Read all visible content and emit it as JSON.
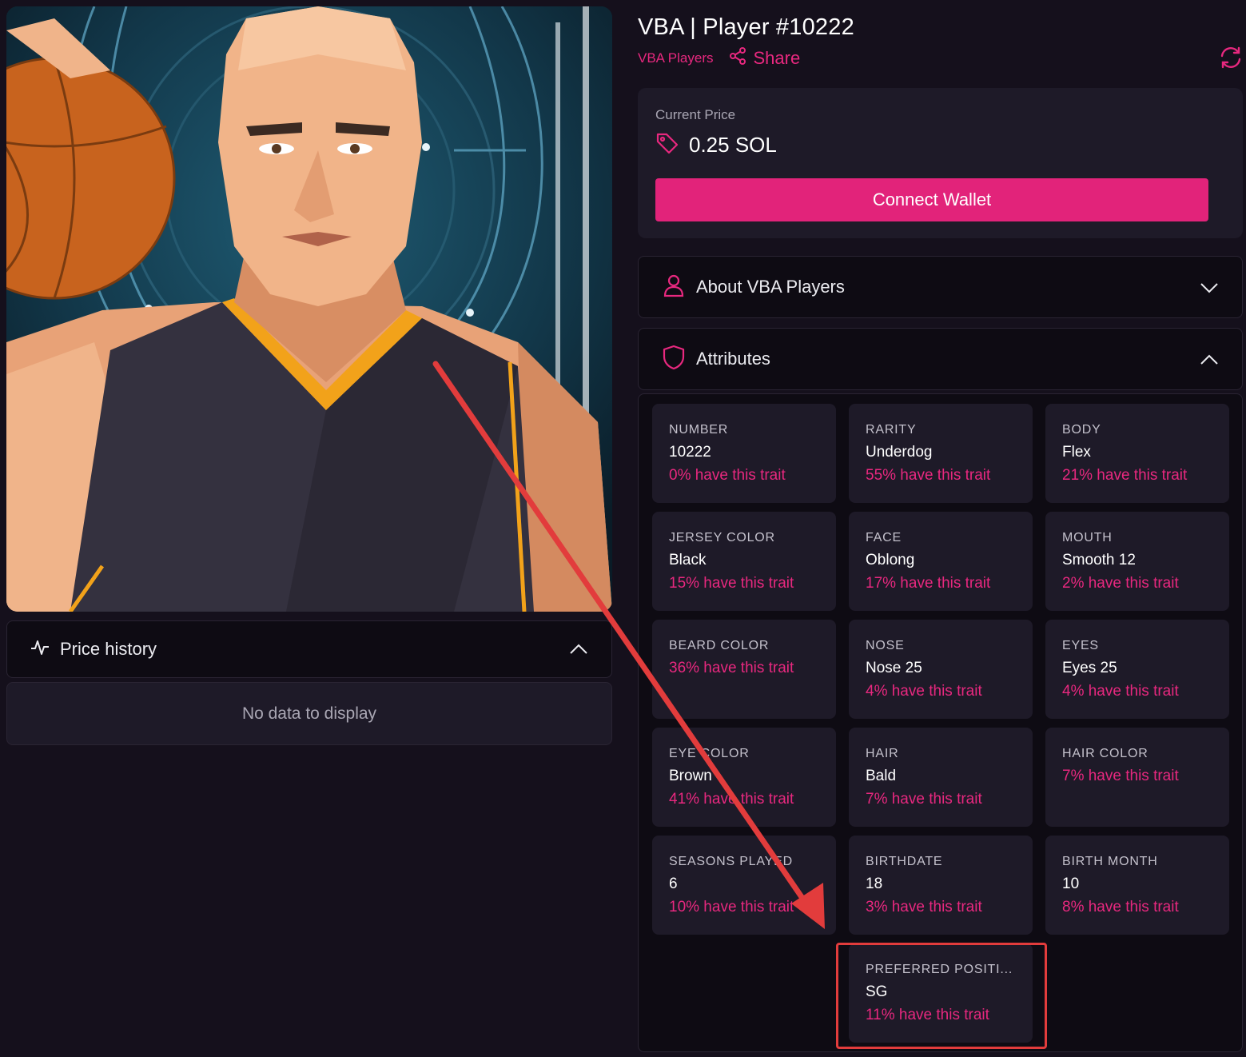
{
  "header": {
    "title": "VBA | Player #10222",
    "collection_link": "VBA Players",
    "share_label": "Share"
  },
  "price": {
    "label": "Current Price",
    "value": "0.25 SOL",
    "connect_label": "Connect Wallet"
  },
  "price_history": {
    "title": "Price history",
    "empty": "No data to display"
  },
  "about": {
    "label": "About VBA Players"
  },
  "attributes": {
    "label": "Attributes",
    "traits": [
      {
        "name": "NUMBER",
        "value": "10222",
        "pct": "0% have this trait"
      },
      {
        "name": "RARITY",
        "value": "Underdog",
        "pct": "55% have this trait"
      },
      {
        "name": "BODY",
        "value": "Flex",
        "pct": "21% have this trait"
      },
      {
        "name": "JERSEY COLOR",
        "value": "Black",
        "pct": "15% have this trait"
      },
      {
        "name": "FACE",
        "value": "Oblong",
        "pct": "17% have this trait"
      },
      {
        "name": "MOUTH",
        "value": "Smooth 12",
        "pct": "2% have this trait"
      },
      {
        "name": "BEARD COLOR",
        "value": "",
        "pct": "36% have this trait"
      },
      {
        "name": "NOSE",
        "value": "Nose 25",
        "pct": "4% have this trait"
      },
      {
        "name": "EYES",
        "value": "Eyes 25",
        "pct": "4% have this trait"
      },
      {
        "name": "EYE COLOR",
        "value": "Brown",
        "pct": "41% have this trait"
      },
      {
        "name": "HAIR",
        "value": "Bald",
        "pct": "7% have this trait"
      },
      {
        "name": "HAIR COLOR",
        "value": "",
        "pct": "7% have this trait"
      },
      {
        "name": "SEASONS PLAYED",
        "value": "6",
        "pct": "10% have this trait"
      },
      {
        "name": "BIRTHDATE",
        "value": "18",
        "pct": "3% have this trait"
      },
      {
        "name": "BIRTH MONTH",
        "value": "10",
        "pct": "8% have this trait"
      },
      {
        "name": "PREFERRED POSITI...",
        "value": "SG",
        "pct": "11% have this trait"
      }
    ]
  },
  "colors": {
    "accent": "#e8287f",
    "button": "#e2237a",
    "background": "#15101c",
    "card": "#1e1a28",
    "annotation": "#e23c3c"
  },
  "icons": [
    "refresh-icon",
    "share-icon",
    "price-tag-icon",
    "user-icon",
    "shield-icon",
    "activity-icon",
    "chevron-down-icon",
    "chevron-up-icon"
  ]
}
